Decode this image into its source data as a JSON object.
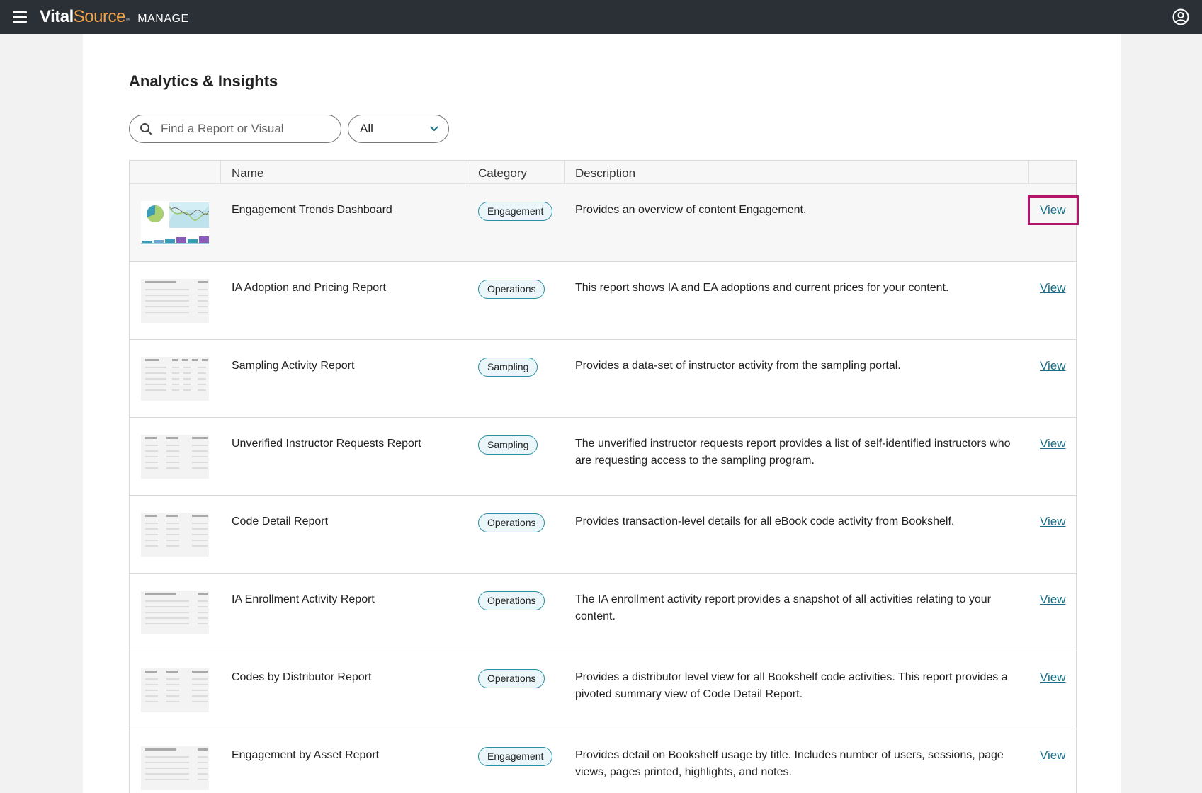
{
  "header": {
    "brand_vital": "Vital",
    "brand_source": "Source",
    "brand_tm": "™",
    "brand_product": "MANAGE"
  },
  "page": {
    "title": "Analytics & Insights"
  },
  "filters": {
    "search_placeholder": "Find a Report or Visual",
    "category_selected": "All"
  },
  "table": {
    "columns": [
      "",
      "Name",
      "Category",
      "Description",
      ""
    ],
    "action_label": "View",
    "rows": [
      {
        "name": "Engagement Trends Dashboard",
        "category": "Engagement",
        "description": "Provides an overview of content Engagement.",
        "thumb": "dashboard"
      },
      {
        "name": "IA Adoption and Pricing Report",
        "category": "Operations",
        "description": "This report shows IA and EA adoptions and current prices for your content.",
        "thumb": "table-a"
      },
      {
        "name": "Sampling Activity Report",
        "category": "Sampling",
        "description": "Provides a data-set of instructor activity from the sampling portal.",
        "thumb": "table-b"
      },
      {
        "name": "Unverified Instructor Requests Report",
        "category": "Sampling",
        "description": "The unverified instructor requests report provides a list of self-identified instructors who are requesting access to the sampling program.",
        "thumb": "table-c"
      },
      {
        "name": "Code Detail Report",
        "category": "Operations",
        "description": "Provides transaction-level details for all eBook code activity from Bookshelf.",
        "thumb": "table-c"
      },
      {
        "name": "IA Enrollment Activity Report",
        "category": "Operations",
        "description": "The IA enrollment activity report provides a snapshot of all activities relating to your content.",
        "thumb": "table-a"
      },
      {
        "name": "Codes by Distributor Report",
        "category": "Operations",
        "description": "Provides a distributor level view for all Bookshelf code activities. This report provides a pivoted summary view of Code Detail Report.",
        "thumb": "table-c"
      },
      {
        "name": "Engagement by Asset Report",
        "category": "Engagement",
        "description": "Provides detail on Bookshelf usage by title. Includes number of users, sessions, page views, pages printed, highlights, and notes.",
        "thumb": "table-a"
      }
    ]
  },
  "colors": {
    "topbar": "#2b2f36",
    "brand_accent": "#f0a34a",
    "badge_border": "#2a8fa0",
    "link": "#1a6f86",
    "highlight": "#b2166c"
  },
  "icons": {
    "menu": "hamburger-icon",
    "user": "user-circle-icon",
    "search": "search-icon",
    "dropdown": "chevron-down-icon"
  }
}
